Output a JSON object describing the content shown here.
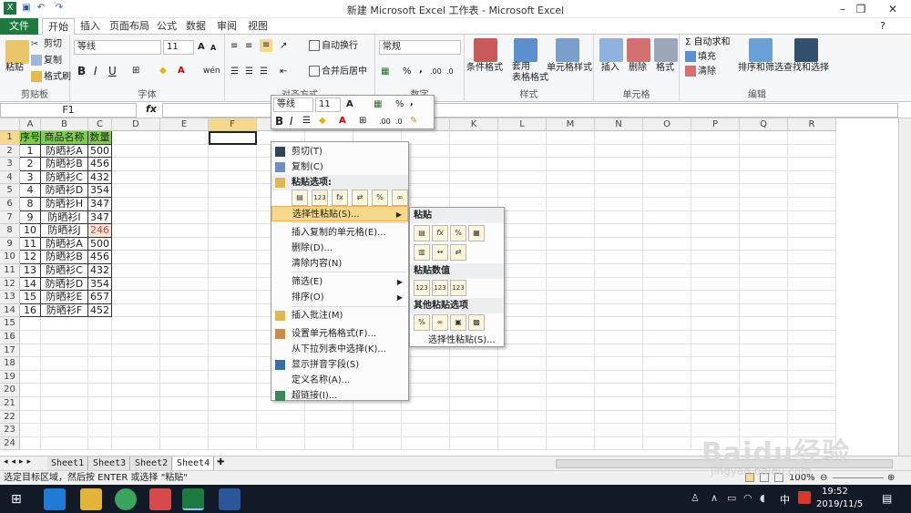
{
  "window": {
    "title": "新建 Microsoft Excel 工作表 - Microsoft Excel"
  },
  "tabs": [
    "文件",
    "开始",
    "插入",
    "页面布局",
    "公式",
    "数据",
    "审阅",
    "视图"
  ],
  "ribbon": {
    "clipboard": {
      "paste": "粘贴",
      "cut": "剪切",
      "copy": "复制",
      "format_painter": "格式刷",
      "label": "剪贴板"
    },
    "font": {
      "name": "等线",
      "size": "11",
      "grow": "A",
      "shrink": "A",
      "bold": "B",
      "italic": "I",
      "underline": "U",
      "phonetic": "wén",
      "label": "字体"
    },
    "alignment": {
      "wrap": "自动换行",
      "merge": "合并后居中",
      "label": "对齐方式"
    },
    "number": {
      "format": "常规",
      "percent": "%",
      "comma": ",",
      "label": "数字"
    },
    "styles": {
      "conditional": "条件格式",
      "table": "套用\n表格格式",
      "cell_styles": "单元格样式",
      "label": "样式"
    },
    "cells": {
      "insert": "插入",
      "delete": "删除",
      "format": "格式",
      "label": "单元格"
    },
    "editing": {
      "autosum": "Σ 自动求和",
      "fill": "填充",
      "clear": "清除",
      "sort": "排序和筛选",
      "find": "查找和选择",
      "label": "编辑"
    }
  },
  "formula_bar": {
    "name_box": "F1",
    "fx": "fx",
    "content": ""
  },
  "columns": [
    "A",
    "B",
    "C",
    "D",
    "E",
    "F",
    "G",
    "H",
    "I",
    "J",
    "K",
    "L",
    "M",
    "N",
    "O",
    "P",
    "Q",
    "R"
  ],
  "rows": [
    "1",
    "2",
    "3",
    "4",
    "5",
    "6",
    "7",
    "8",
    "9",
    "10",
    "11",
    "12",
    "13",
    "14",
    "15",
    "16",
    "17",
    "18",
    "19",
    "20",
    "21",
    "22",
    "23",
    "24"
  ],
  "table": {
    "headers": [
      "序号",
      "商品名称",
      "数量"
    ],
    "rows": [
      [
        "1",
        "防晒衫A",
        "500"
      ],
      [
        "2",
        "防晒衫B",
        "456"
      ],
      [
        "3",
        "防晒衫C",
        "432"
      ],
      [
        "4",
        "防晒衫D",
        "354"
      ],
      [
        "8",
        "防晒衫H",
        "347"
      ],
      [
        "9",
        "防晒衫I",
        "347"
      ],
      [
        "10",
        "防晒衫J",
        "246"
      ],
      [
        "11",
        "防晒衫A",
        "500"
      ],
      [
        "12",
        "防晒衫B",
        "456"
      ],
      [
        "13",
        "防晒衫C",
        "432"
      ],
      [
        "14",
        "防晒衫D",
        "354"
      ],
      [
        "15",
        "防晒衫E",
        "657"
      ],
      [
        "16",
        "防晒衫F",
        "452"
      ]
    ]
  },
  "mini_toolbar": {
    "font": "等线",
    "size": "11",
    "bold": "B",
    "italic": "I",
    "percent": "%",
    "comma": ","
  },
  "context_menu": {
    "items": [
      "剪切(T)",
      "复制(C)",
      "粘贴选项:",
      "选择性粘贴(S)...",
      "插入复制的单元格(E)...",
      "删除(D)...",
      "清除内容(N)",
      "筛选(E)",
      "排序(O)",
      "插入批注(M)",
      "设置单元格格式(F)...",
      "从下拉列表中选择(K)...",
      "显示拼音字段(S)",
      "定义名称(A)...",
      "超链接(I)..."
    ]
  },
  "submenu": {
    "paste": "粘贴",
    "paste_values": "粘贴数值",
    "other": "其他粘贴选项",
    "special": "选择性粘贴(S)..."
  },
  "sheets": [
    "Sheet1",
    "Sheet3",
    "Sheet2",
    "Sheet4"
  ],
  "status": {
    "message": "选定目标区域，然后按 ENTER 或选择 \"粘贴\"",
    "zoom": "100%"
  },
  "taskbar": {
    "time": "19:52",
    "date": "2019/11/5",
    "ime": "中",
    "watermark": "Baidu经验",
    "watermark_url": "jingyan.baidu.com"
  },
  "colors": {
    "file_tab": "#1d7a3e",
    "header_fill": "#7bd048",
    "highlight": "#f6d98a",
    "taskbar": "#111a26"
  }
}
